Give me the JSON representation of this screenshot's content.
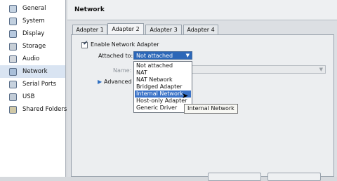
{
  "sidebar": {
    "items": [
      {
        "label": "General",
        "icon": "general-icon"
      },
      {
        "label": "System",
        "icon": "system-icon"
      },
      {
        "label": "Display",
        "icon": "display-icon"
      },
      {
        "label": "Storage",
        "icon": "storage-icon"
      },
      {
        "label": "Audio",
        "icon": "audio-icon"
      },
      {
        "label": "Network",
        "icon": "network-icon",
        "selected": true
      },
      {
        "label": "Serial Ports",
        "icon": "serial-ports-icon"
      },
      {
        "label": "USB",
        "icon": "usb-icon"
      },
      {
        "label": "Shared Folders",
        "icon": "shared-folders-icon"
      }
    ]
  },
  "header": {
    "title": "Network"
  },
  "tabs": [
    {
      "label": "Adapter 1"
    },
    {
      "label": "Adapter 2",
      "active": true
    },
    {
      "label": "Adapter 3"
    },
    {
      "label": "Adapter 4"
    }
  ],
  "adapter": {
    "enable_label": "Enable Network Adapter",
    "enabled": true,
    "attached_label": "Attached to:",
    "attached_value": "Not attached",
    "name_label": "Name:",
    "advanced_label": "Advanced"
  },
  "dropdown": {
    "options": [
      "Not attached",
      "NAT",
      "NAT Network",
      "Bridged Adapter",
      "Internal Network",
      "Host-only Adapter",
      "Generic Driver"
    ],
    "highlighted": "Internal Network"
  },
  "tooltip": {
    "text": "Internal Network"
  },
  "colors": {
    "accent": "#2c67b8",
    "highlight": "#3b73c7"
  }
}
